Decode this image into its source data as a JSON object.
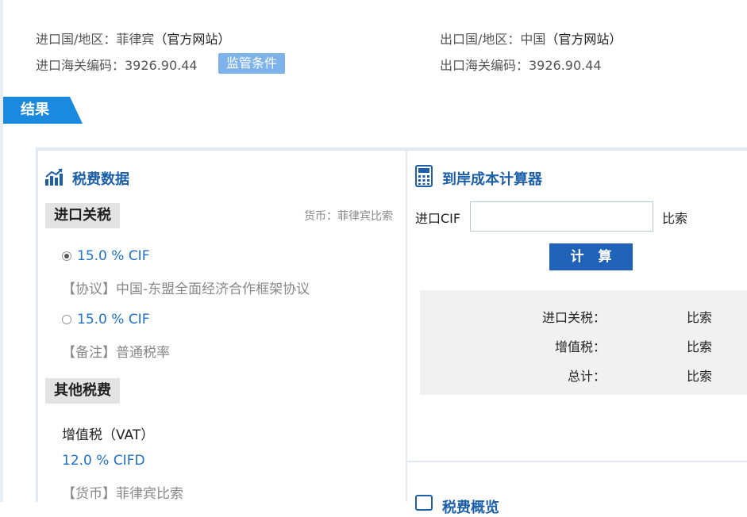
{
  "top": {
    "import_country_label": "进口国/地区：菲律宾",
    "import_site_link": "（官方网站）",
    "import_hs_label": "进口海关编码：3926.90.44",
    "supervision_badge": "监管条件",
    "export_country_label": "出口国/地区：中国",
    "export_site_link": "（官方网站）",
    "export_hs_label": "出口海关编码：3926.90.44"
  },
  "result_ribbon": "结果",
  "tax_panel": {
    "title": "税费数据",
    "import_duty_pill": "进口关税",
    "currency_note": "货币：菲律宾比索",
    "rates": [
      {
        "rate": "15.0 % CIF",
        "note": "【协议】中国-东盟全面经济合作框架协议",
        "selected": true
      },
      {
        "rate": "15.0 % CIF",
        "note": "【备注】普通税率",
        "selected": false
      }
    ],
    "other_taxes_pill": "其他税费",
    "vat_label": "增值税（VAT）",
    "vat_rate": "12.0 % CIFD",
    "vat_currency": "【货币】菲律宾比索"
  },
  "calculator": {
    "title": "到岸成本计算器",
    "cif_label": "进口CIF",
    "cif_value": "",
    "cif_unit": "比索",
    "calc_button": "计 算",
    "results": [
      {
        "label": "进口关税：",
        "value": "比索"
      },
      {
        "label": "增值税：",
        "value": "比索"
      },
      {
        "label": "总计：",
        "value": "比索"
      }
    ],
    "next_section_title": "税费概览"
  },
  "colors": {
    "accent_blue": "#1a8ae0",
    "title_blue": "#1d5fa8",
    "link_blue": "#1e72c8",
    "badge_blue": "#7db3ea",
    "button_blue": "#1f62b8"
  }
}
